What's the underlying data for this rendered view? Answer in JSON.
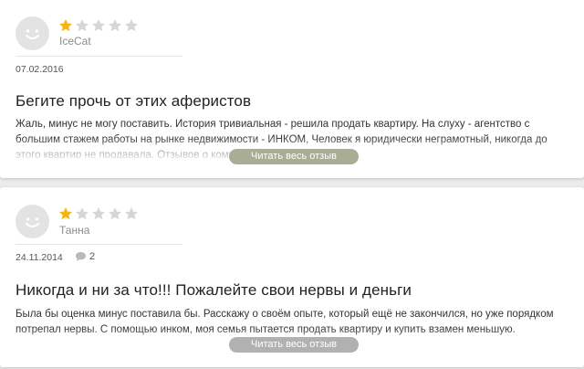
{
  "colors": {
    "star_filled": "#f5b50f",
    "star_empty": "#d6d6d6",
    "read_more_first": "#a9ad94",
    "read_more_second": "#b1b1b1"
  },
  "icons": {
    "avatar": "smiley-avatar-icon",
    "star": "star-icon",
    "comment": "speech-bubble-icon"
  },
  "reviews": [
    {
      "author": "IceCat",
      "rating": 1,
      "max_rating": 5,
      "date": "07.02.2016",
      "title": "Бегите прочь от этих аферистов",
      "text": "Жаль, минус не могу поставить. История тривиальная - решила продать квартиру. На слуху - агентство с большим стажем работы на рынке недвижимости - ИНКОМ, Человек я юридически неграмотный, никогда до этого квартир не продавала. Отзывов о компании в интернете много.",
      "read_more": "Читать весь отзыв"
    },
    {
      "author": "Танна",
      "rating": 1,
      "max_rating": 5,
      "date": "24.11.2014",
      "comments": "2",
      "title": "Никогда и ни за что!!! Пожалейте свои нервы и деньги",
      "text": "Была бы оценка минус поставила бы. Расскажу о своём опыте, который ещё не закончился, но уже порядком потрепал нервы. С помощью инком, моя семья пытается продать квартиру и купить взамен меньшую.",
      "read_more": "Читать весь отзыв"
    }
  ]
}
